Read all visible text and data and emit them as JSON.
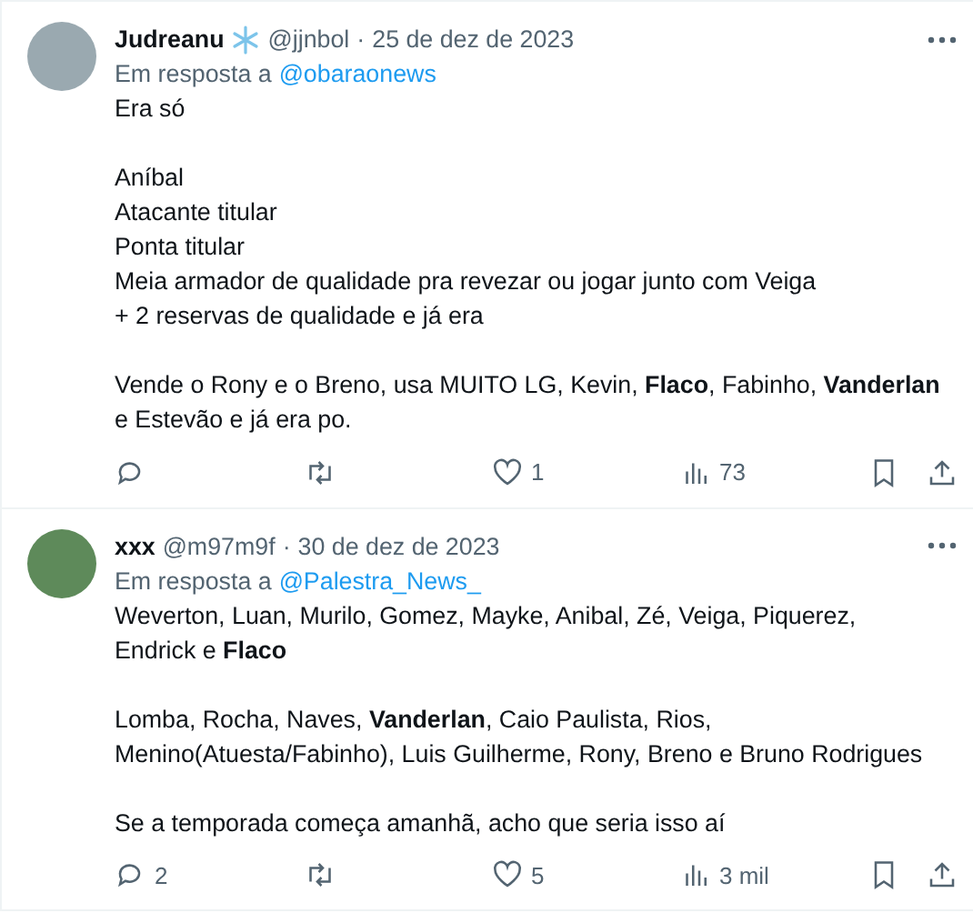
{
  "tweets": [
    {
      "name": "Judreanu",
      "has_badge": true,
      "handle": "@jjnbol",
      "separator": "·",
      "date": "25 de dez de 2023",
      "reply_prefix": "Em resposta a",
      "reply_to": "@obaraonews",
      "paragraphs": [
        [
          "Era só"
        ],
        [
          "Aníbal",
          "Atacante titular",
          "Ponta titular",
          "Meia armador de qualidade pra revezar ou jogar junto com Veiga",
          "+ 2 reservas de qualidade e já era"
        ],
        [
          "Vende o Rony e o Breno, usa MUITO LG, Kevin, **Flaco**, Fabinho, **Vanderlan**",
          "e Estevão e já era po."
        ]
      ],
      "likes": "1",
      "views": "73"
    },
    {
      "name": "xxx",
      "has_badge": false,
      "handle": "@m97m9f",
      "separator": "·",
      "date": "30 de dez de 2023",
      "reply_prefix": "Em resposta a",
      "reply_to": "@Palestra_News_",
      "paragraphs": [
        [
          "Weverton, Luan, Murilo, Gomez, Mayke, Anibal, Zé, Veiga, Piquerez,",
          "Endrick e **Flaco**"
        ],
        [
          "Lomba, Rocha, Naves, **Vanderlan**, Caio Paulista, Rios,",
          "Menino(Atuesta/Fabinho), Luis Guilherme, Rony, Breno e Bruno Rodrigues"
        ],
        [
          "Se a temporada começa amanhã, acho que seria isso aí"
        ]
      ],
      "replies": "2",
      "likes": "5",
      "views": "3 mil"
    }
  ]
}
